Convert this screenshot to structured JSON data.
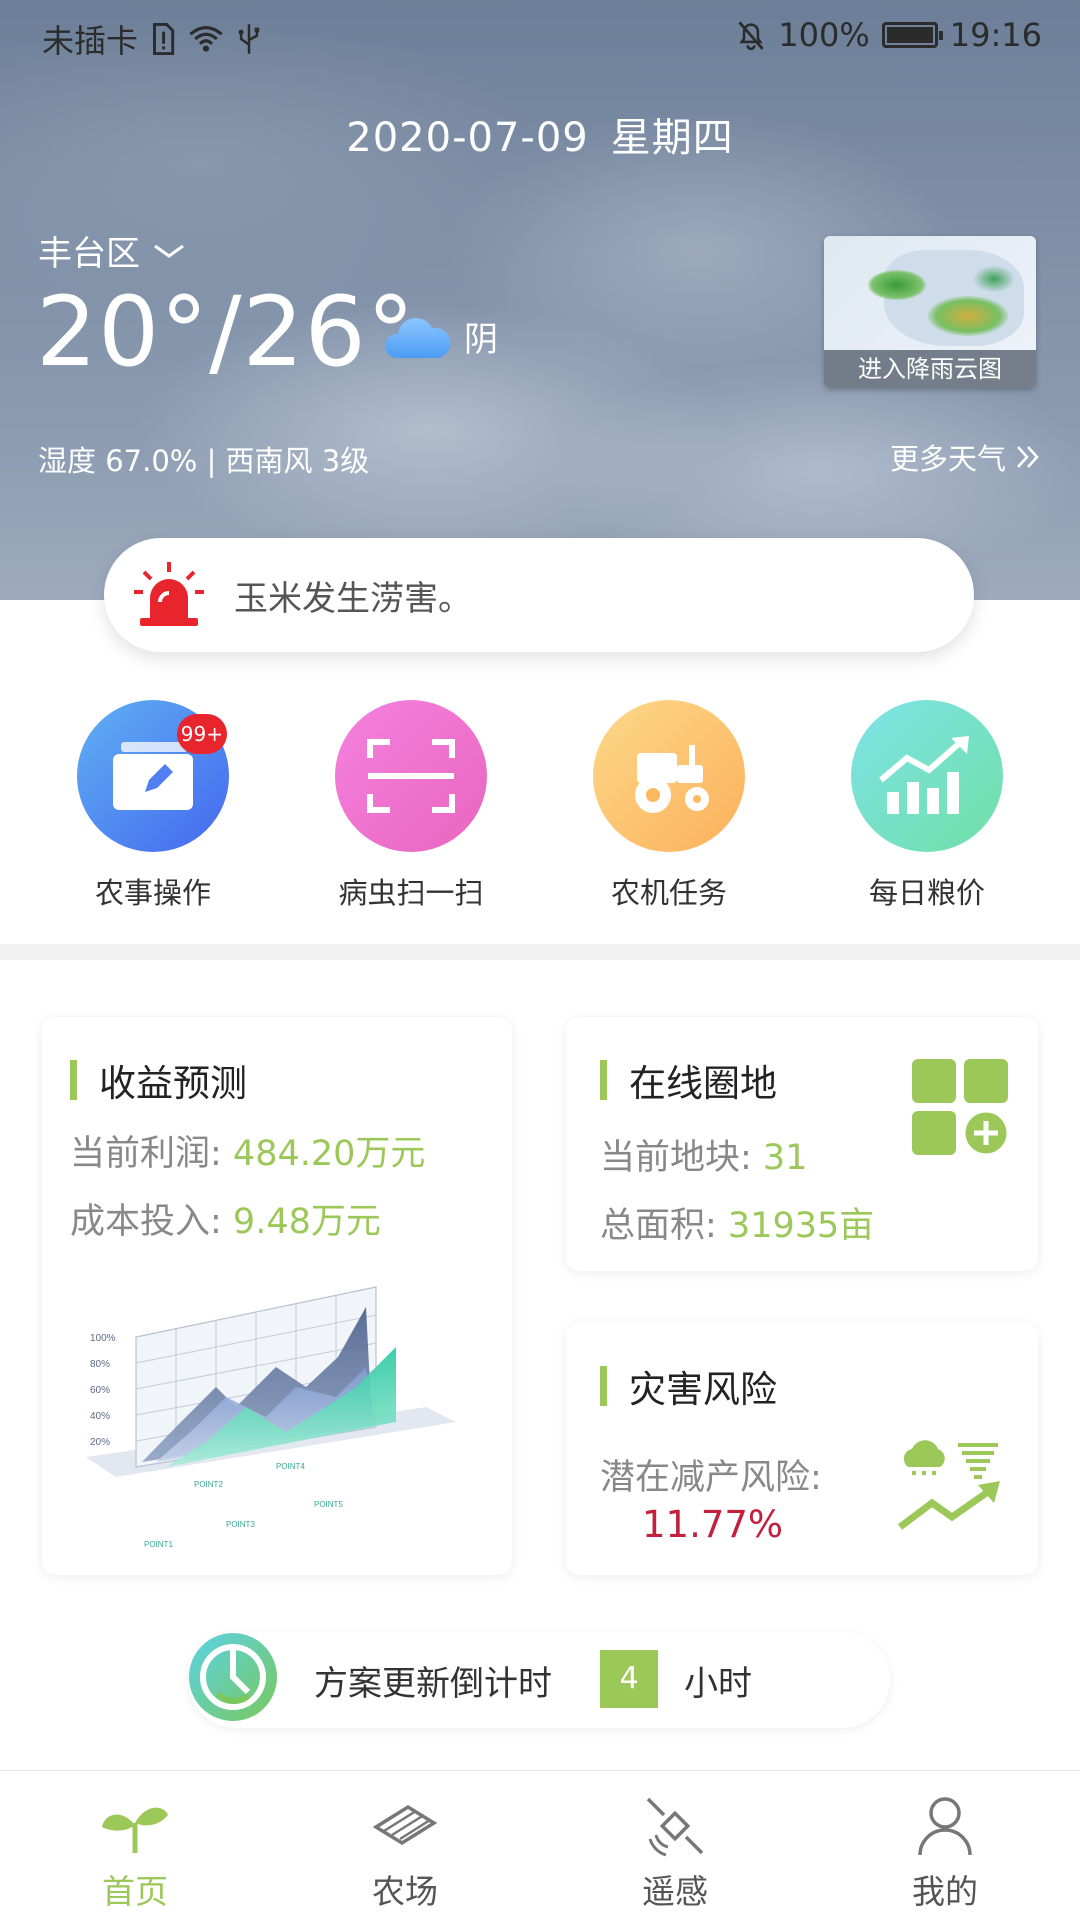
{
  "status_bar": {
    "carrier": "未插卡",
    "battery": "100%",
    "time": "19:16"
  },
  "weather": {
    "date": "2020-07-09",
    "weekday": "星期四",
    "location": "丰台区",
    "temperature": "20°/26°",
    "condition": "阴",
    "humidity_wind": "湿度 67.0% | 西南风 3级",
    "radar_label": "进入降雨云图",
    "more_weather": "更多天气"
  },
  "alert": {
    "message": "玉米发生涝害。"
  },
  "quick_actions": [
    {
      "label": "农事操作",
      "badge": "99+",
      "icon": "edit-folder-icon",
      "color_from": "#5aa7f2",
      "color_to": "#4a6cf0"
    },
    {
      "label": "病虫扫一扫",
      "icon": "scan-icon",
      "color_from": "#f07ad8",
      "color_to": "#e96cc0"
    },
    {
      "label": "农机任务",
      "icon": "tractor-icon",
      "color_from": "#fcd27a",
      "color_to": "#fbb05a"
    },
    {
      "label": "每日粮价",
      "icon": "rising-chart-icon",
      "color_from": "#7ce0e0",
      "color_to": "#6fe0a8"
    }
  ],
  "cards": {
    "profit": {
      "title": "收益预测",
      "profit_label": "当前利润: ",
      "profit_value": "484.20万元",
      "cost_label": "成本投入: ",
      "cost_value": "9.48万元",
      "chart_ticks": [
        "100%",
        "80%",
        "60%",
        "40%",
        "20%"
      ],
      "chart_points": [
        "POINT1",
        "POINT2",
        "POINT3",
        "POINT4",
        "POINT5"
      ]
    },
    "land": {
      "title": "在线圈地",
      "plots_label": "当前地块: ",
      "plots_value": "31",
      "area_label": "总面积: ",
      "area_value": "31935亩"
    },
    "disaster": {
      "title": "灾害风险",
      "risk_label": "潜在减产风险:",
      "risk_value": "11.77%"
    }
  },
  "countdown": {
    "text": "方案更新倒计时",
    "hours": "4",
    "unit": "小时"
  },
  "nav": [
    {
      "label": "首页",
      "icon": "sprout-icon",
      "active": true
    },
    {
      "label": "农场",
      "icon": "field-icon",
      "active": false
    },
    {
      "label": "遥感",
      "icon": "satellite-icon",
      "active": false
    },
    {
      "label": "我的",
      "icon": "user-icon",
      "active": false
    }
  ],
  "colors": {
    "accent_green": "#9cc85a",
    "risk_red": "#c3203e",
    "badge_red": "#e8242c",
    "alert_red": "#e8242c"
  }
}
